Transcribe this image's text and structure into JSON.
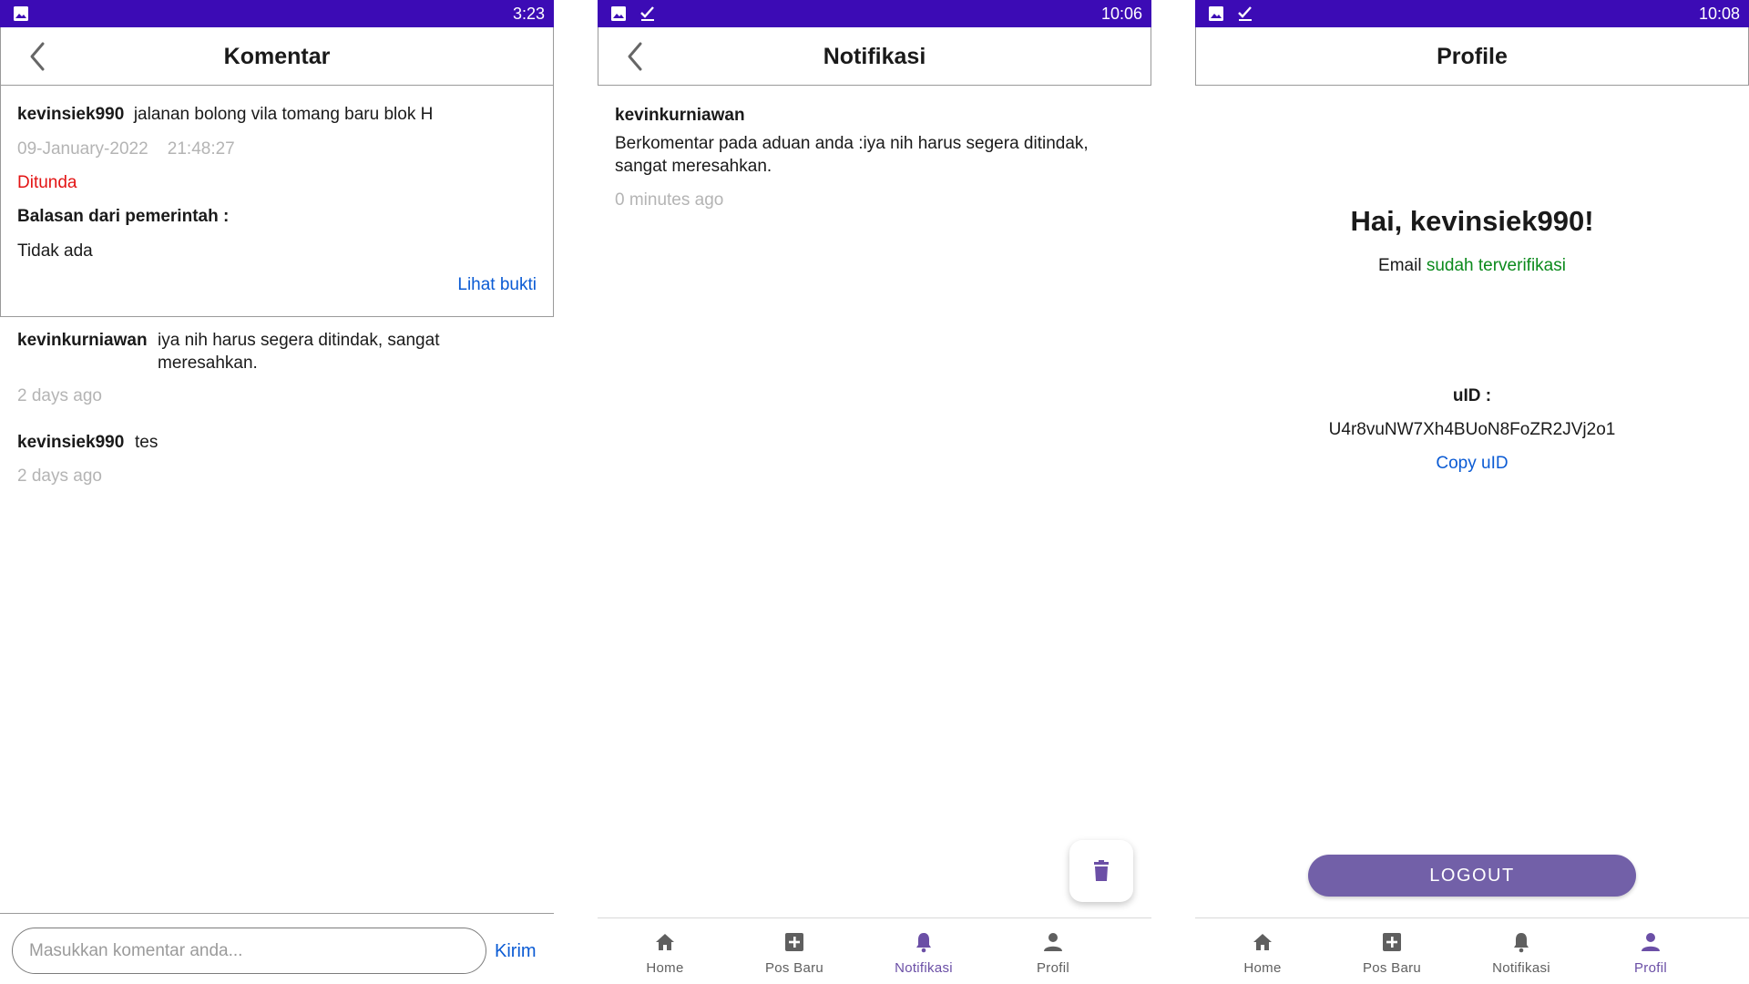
{
  "colors": {
    "status_bar": "#3c0bb5",
    "accent": "#7260a8",
    "link": "#0b5bd4",
    "pending": "#e31414",
    "verified": "#0b8a1c",
    "muted": "#b4b4b4"
  },
  "komentar": {
    "status_time": "3:23",
    "title": "Komentar",
    "post": {
      "user": "kevinsiek990",
      "text": "jalanan bolong vila tomang baru blok H",
      "date": "09-January-2022",
      "time": "21:48:27",
      "status": "Ditunda",
      "reply_header": "Balasan dari pemerintah :",
      "reply_value": "Tidak ada",
      "proof_link": "Lihat bukti"
    },
    "comments": [
      {
        "user": "kevinkurniawan",
        "text": "iya nih harus segera ditindak, sangat meresahkan.",
        "time": "2 days ago"
      },
      {
        "user": "kevinsiek990",
        "text": "tes",
        "time": "2 days ago"
      }
    ],
    "input_placeholder": "Masukkan komentar anda...",
    "send_label": "Kirim"
  },
  "notifikasi": {
    "status_time": "10:06",
    "title": "Notifikasi",
    "items": [
      {
        "user": "kevinkurniawan",
        "text": "Berkomentar pada aduan anda :iya nih harus segera ditindak, sangat meresahkan.",
        "time": "0 minutes ago"
      }
    ],
    "fab_icon": "trash-icon"
  },
  "profile": {
    "status_time": "10:08",
    "title": "Profile",
    "greeting": "Hai, kevinsiek990!",
    "email_label": "Email",
    "email_status": "sudah terverifikasi",
    "uid_label": "uID :",
    "uid_value": "U4r8vuNW7Xh4BUoN8FoZR2JVj2o1",
    "copy_label": "Copy uID",
    "logout_label": "LOGOUT"
  },
  "nav": {
    "items": [
      {
        "label": "Home",
        "icon": "home-icon"
      },
      {
        "label": "Pos Baru",
        "icon": "add-box-icon"
      },
      {
        "label": "Notifikasi",
        "icon": "bell-icon"
      },
      {
        "label": "Profil",
        "icon": "person-icon"
      }
    ]
  }
}
